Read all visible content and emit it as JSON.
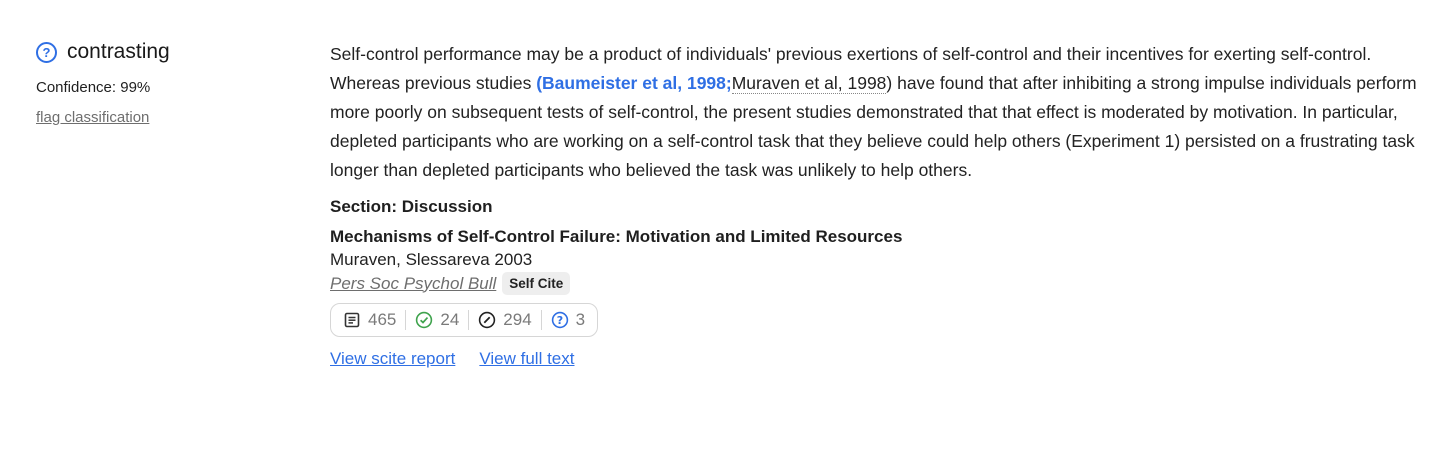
{
  "classification": {
    "label": "contrasting",
    "confidence": "Confidence: 99%",
    "flag_link": "flag classification",
    "icon": "question-circle-icon",
    "accent_color": "#2f6fe4"
  },
  "citation": {
    "text_before": "Self-control performance may be a product of individuals' previous exertions of self-control and their incentives for exerting self-control. Whereas previous studies ",
    "cite_bold": "(Baumeister et al, 1998;",
    "cite_plain": "Muraven et al, 1998",
    "text_after": ") have found that after inhibiting a strong impulse individuals perform more poorly on subsequent tests of self-control, the present studies demonstrated that that effect is moderated by motivation. In particular, depleted participants who are working on a self-control task that they believe could help others (Experiment 1) persisted on a frustrating task longer than depleted participants who believed the task was unlikely to help others."
  },
  "section": "Section: Discussion",
  "paper": {
    "title": "Mechanisms of Self-Control Failure: Motivation and Limited Resources",
    "authors": "Muraven, Slessareva 2003",
    "journal": "Pers Soc Psychol Bull",
    "badge": "Self Cite"
  },
  "tally": {
    "citing_publications": "465",
    "supporting": "24",
    "mentioning": "294",
    "contrasting": "3",
    "icons": [
      "document-icon",
      "check-circle-icon",
      "slash-circle-icon",
      "question-circle-icon"
    ],
    "colors": {
      "supporting": "#3fa34d",
      "contrasting": "#2f6fe4"
    }
  },
  "links": {
    "report": "View scite report",
    "full_text": "View full text"
  }
}
